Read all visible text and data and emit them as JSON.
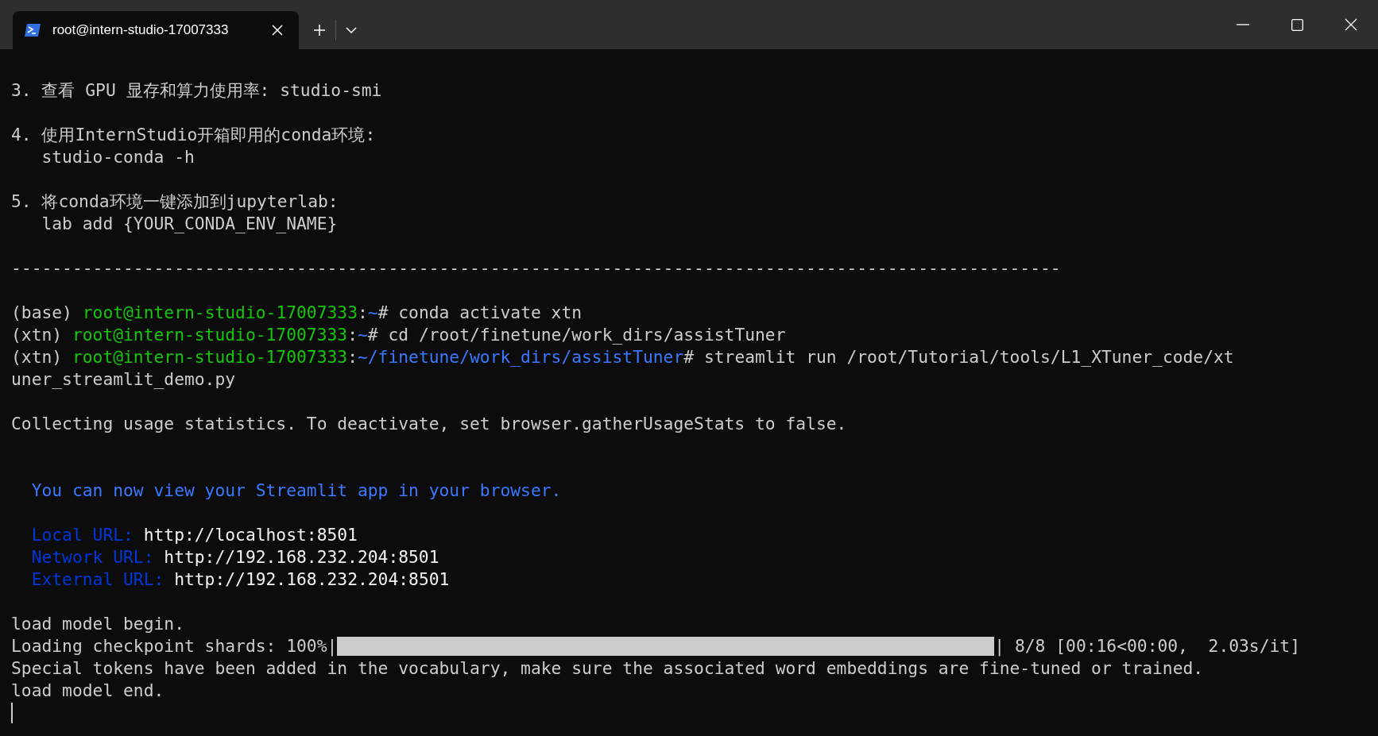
{
  "window": {
    "tab_title": "root@intern-studio-17007333"
  },
  "terminal": {
    "blocks": [
      {
        "lines": [
          [
            {
              "kind": "text",
              "text": "3. 查看 GPU 显存和算力使用率: studio-smi"
            }
          ]
        ]
      },
      {
        "lines": [
          [
            {
              "kind": "text",
              "text": "4. 使用InternStudio开箱即用的conda环境:"
            }
          ],
          [
            {
              "kind": "text",
              "text": "   studio-conda -h"
            }
          ]
        ]
      },
      {
        "lines": [
          [
            {
              "kind": "text",
              "text": "5. 将conda环境一键添加到jupyterlab:"
            }
          ],
          [
            {
              "kind": "text",
              "text": "   lab add {YOUR_CONDA_ENV_NAME}"
            }
          ]
        ]
      },
      {
        "lines": [
          [
            {
              "kind": "text",
              "text": "-------------------------------------------------------------------------------------------------------"
            }
          ]
        ]
      },
      {
        "lines": [
          [
            {
              "kind": "text",
              "text": "(base) "
            },
            {
              "kind": "user",
              "text": "root@intern-studio-17007333"
            },
            {
              "kind": "text",
              "text": ":"
            },
            {
              "kind": "path",
              "text": "~"
            },
            {
              "kind": "text",
              "text": "# conda activate xtn"
            }
          ],
          [
            {
              "kind": "text",
              "text": "(xtn) "
            },
            {
              "kind": "user",
              "text": "root@intern-studio-17007333"
            },
            {
              "kind": "text",
              "text": ":"
            },
            {
              "kind": "path",
              "text": "~"
            },
            {
              "kind": "text",
              "text": "# cd /root/finetune/work_dirs/assistTuner"
            }
          ],
          [
            {
              "kind": "text",
              "text": "(xtn) "
            },
            {
              "kind": "user",
              "text": "root@intern-studio-17007333"
            },
            {
              "kind": "text",
              "text": ":"
            },
            {
              "kind": "path",
              "text": "~/finetune/work_dirs/assistTuner"
            },
            {
              "kind": "text",
              "text": "# streamlit run /root/Tutorial/tools/L1_XTuner_code/xt"
            }
          ],
          [
            {
              "kind": "text",
              "text": "uner_streamlit_demo.py"
            }
          ]
        ]
      },
      {
        "lines": [
          [
            {
              "kind": "text",
              "text": "Collecting usage statistics. To deactivate, set browser.gatherUsageStats to false."
            }
          ]
        ]
      },
      {
        "lines": [
          [
            {
              "kind": "notice",
              "text": "  You can now view your Streamlit app in your browser."
            }
          ]
        ]
      },
      {
        "lines": [
          [
            {
              "kind": "label",
              "text": "  Local URL: "
            },
            {
              "kind": "value",
              "text": "http://localhost:8501"
            }
          ],
          [
            {
              "kind": "label",
              "text": "  Network URL: "
            },
            {
              "kind": "value",
              "text": "http://192.168.232.204:8501"
            }
          ],
          [
            {
              "kind": "label",
              "text": "  External URL: "
            },
            {
              "kind": "value",
              "text": "http://192.168.232.204:8501"
            }
          ]
        ]
      },
      {
        "lines": [
          [
            {
              "kind": "text",
              "text": "load model begin."
            }
          ],
          [
            {
              "kind": "text",
              "text": "Loading checkpoint shards: 100%|"
            },
            {
              "kind": "bar",
              "level": 1
            },
            {
              "kind": "text",
              "text": "| 8/8 [00:16<00:00,  2.03s/it]"
            }
          ],
          [
            {
              "kind": "text",
              "text": "Special tokens have been added in the vocabulary, make sure the associated word embeddings are fine-tuned or trained."
            }
          ],
          [
            {
              "kind": "text",
              "text": "load model end."
            }
          ]
        ]
      }
    ],
    "cursor": true
  }
}
